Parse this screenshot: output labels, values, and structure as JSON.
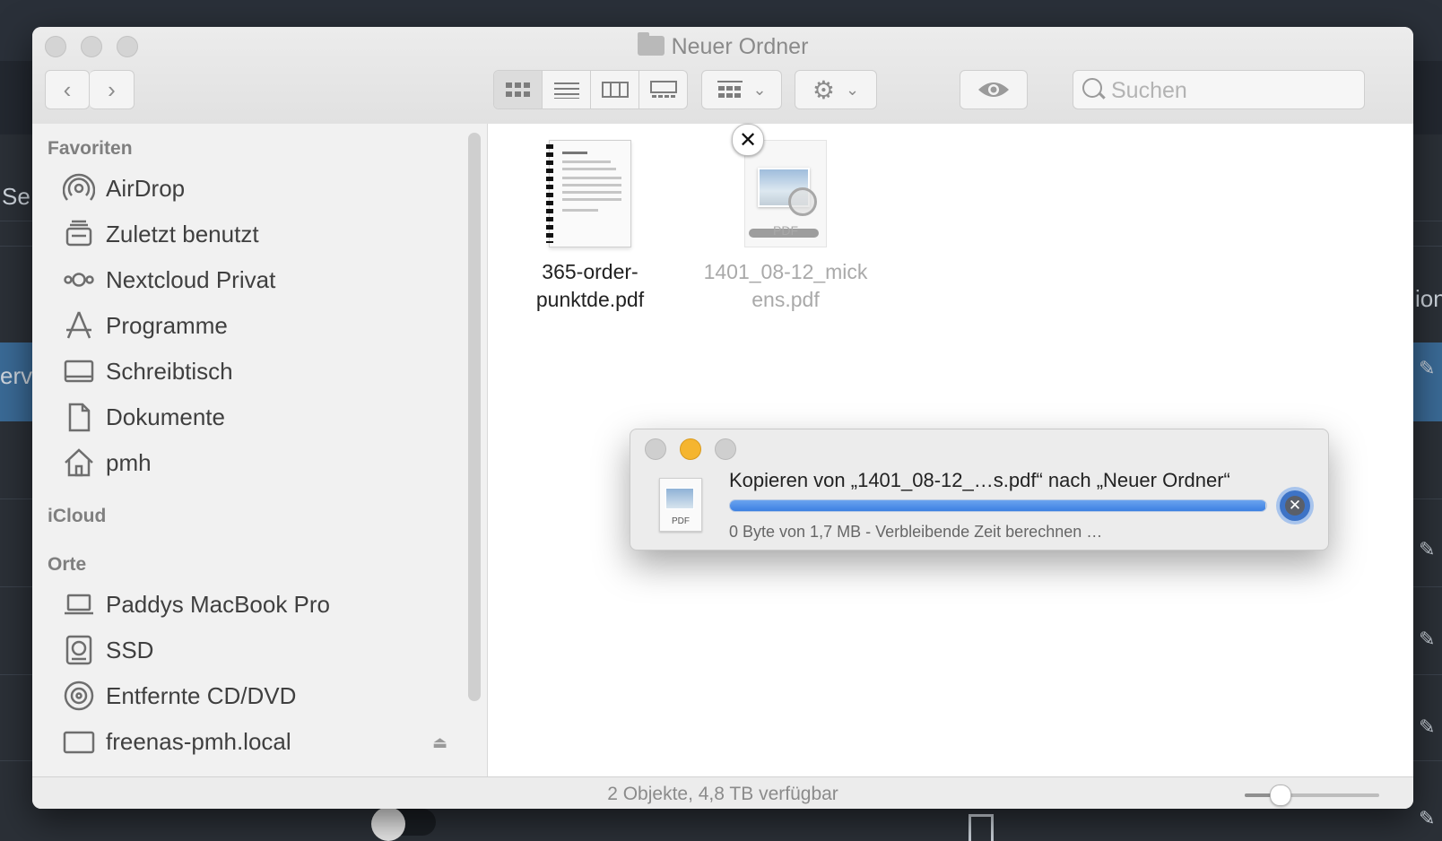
{
  "background_app": {
    "left_text_1": "Se",
    "left_text_2": "erv",
    "right_text": "ion"
  },
  "window": {
    "title": "Neuer Ordner",
    "view_buttons": [
      "icon-view",
      "list-view",
      "column-view",
      "gallery-view"
    ],
    "search_placeholder": "Suchen"
  },
  "sidebar": {
    "sections": [
      {
        "heading": "Favoriten",
        "items": [
          {
            "label": "AirDrop",
            "icon": "airdrop-icon"
          },
          {
            "label": "Zuletzt benutzt",
            "icon": "recents-icon"
          },
          {
            "label": "Nextcloud Privat",
            "icon": "nextcloud-icon"
          },
          {
            "label": "Programme",
            "icon": "applications-icon"
          },
          {
            "label": "Schreibtisch",
            "icon": "desktop-icon"
          },
          {
            "label": "Dokumente",
            "icon": "documents-icon"
          },
          {
            "label": "pmh",
            "icon": "home-icon"
          }
        ]
      },
      {
        "heading": "iCloud",
        "items": []
      },
      {
        "heading": "Orte",
        "items": [
          {
            "label": "Paddys MacBook Pro",
            "icon": "laptop-icon"
          },
          {
            "label": "SSD",
            "icon": "drive-icon"
          },
          {
            "label": "Entfernte CD/DVD",
            "icon": "disc-icon"
          },
          {
            "label": "freenas-pmh.local",
            "icon": "server-icon"
          }
        ]
      }
    ]
  },
  "files": [
    {
      "name_line1": "365-order-",
      "name_line2": "punktde.pdf"
    },
    {
      "name_line1": "1401_08-12_mick",
      "name_line2": "ens.pdf",
      "badge": "PDF"
    }
  ],
  "status": {
    "text": "2 Objekte, 4,8 TB verfügbar",
    "zoom_level": 0.26
  },
  "copy_dialog": {
    "title": "Kopieren von „1401_08-12_…s.pdf“ nach „Neuer Ordner“",
    "progress": 0.998,
    "subtitle": "0 Byte von 1,7 MB - Verbleibende Zeit berechnen …",
    "file_label": "PDF"
  },
  "colors": {
    "accent": "#3c80e2",
    "dialog_minimize": "#f5b52f"
  }
}
